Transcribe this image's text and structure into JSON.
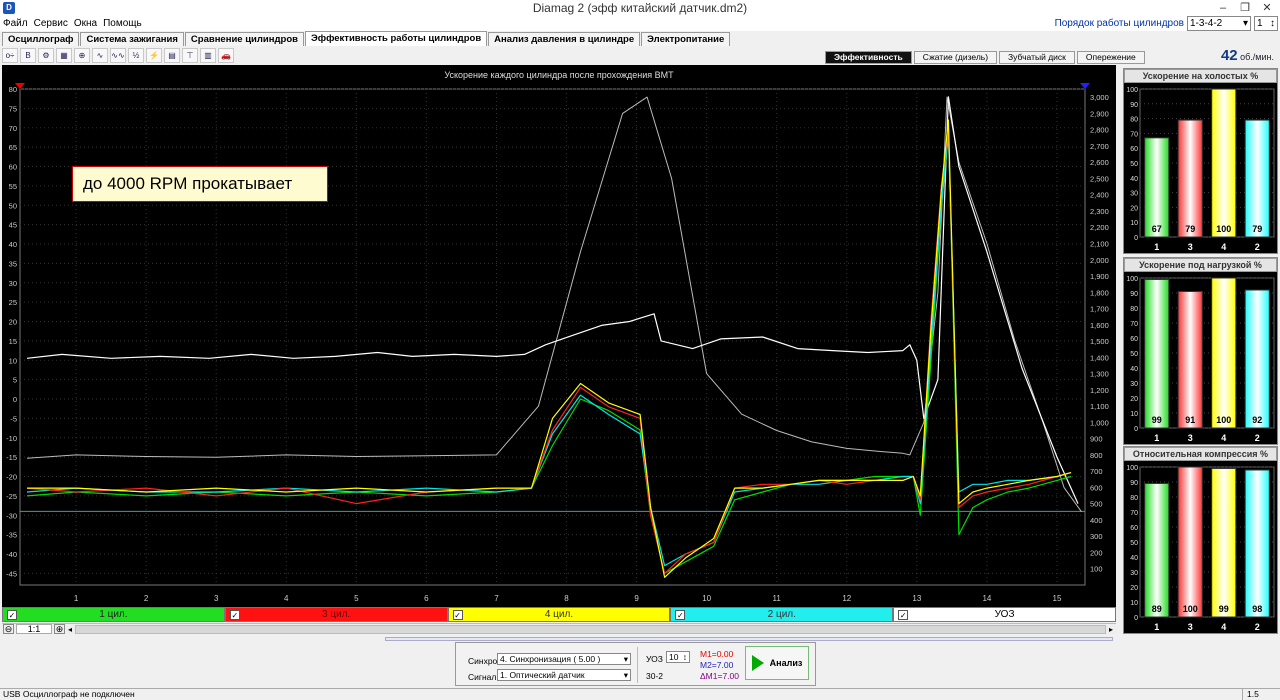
{
  "window": {
    "app_icon": "D",
    "title": "Diamag 2 (эфф китайский датчик.dm2)",
    "minimize": "–",
    "restore": "❐",
    "close": "✕"
  },
  "menu": [
    "Файл",
    "Сервис",
    "Окна",
    "Помощь"
  ],
  "cylinder_order": {
    "label": "Порядок работы цилиндров",
    "value": "1-3-4-2",
    "count": "1"
  },
  "tabs": [
    {
      "label": "Осциллограф",
      "active": false
    },
    {
      "label": "Система зажигания",
      "active": false
    },
    {
      "label": "Сравнение цилиндров",
      "active": false
    },
    {
      "label": "Эффективность работы цилиндров",
      "active": true
    },
    {
      "label": "Анализ давления в цилиндре",
      "active": false
    },
    {
      "label": "Электропитание",
      "active": false
    }
  ],
  "toolbar_icons": [
    "scale-icon",
    "marker-b-icon",
    "rpm-icon",
    "grid-icon",
    "cursor-icon",
    "wave-icon",
    "wave-vvt-icon",
    "alg-icon",
    "sensor-icon",
    "table-icon",
    "filter-icon",
    "bar-chart-icon",
    "car-icon"
  ],
  "toolbar_glyphs": [
    "o÷",
    "B",
    "⚙",
    "▦",
    "⊕",
    "∿",
    "∿∿",
    "½",
    "⚡",
    "▤",
    "⊤",
    "▥",
    "🚗"
  ],
  "subtabs": [
    {
      "label": "Эффективность",
      "active": true
    },
    {
      "label": "Сжатие (дизель)",
      "active": false
    },
    {
      "label": "Зубчатый диск",
      "active": false
    },
    {
      "label": "Опережение",
      "active": false
    }
  ],
  "rpm": {
    "value": "42",
    "unit": "об./мин."
  },
  "annotation": "до 4000 RPM прокатывает",
  "chart_data": {
    "type": "line",
    "title": "Ускорение каждого цилиндра после прохождения ВМТ",
    "x_ticks": [
      "1",
      "2",
      "3",
      "4",
      "5",
      "6",
      "7",
      "8",
      "9",
      "10",
      "11",
      "12",
      "13",
      "14",
      "15"
    ],
    "xlim": [
      0.2,
      15.4
    ],
    "y_left_ticks": [
      "80",
      "75",
      "70",
      "65",
      "60",
      "55",
      "50",
      "45",
      "40",
      "35",
      "30",
      "25",
      "20",
      "15",
      "10",
      "5",
      "0",
      "-5",
      "-10",
      "-15",
      "-20",
      "-25",
      "-30",
      "-35",
      "-40",
      "-45"
    ],
    "ylim_left": [
      -48,
      80
    ],
    "y_right_ticks": [
      "3,000",
      "2,900",
      "2,800",
      "2,700",
      "2,600",
      "2,500",
      "2,400",
      "2,300",
      "2,200",
      "2,100",
      "2,000",
      "1,900",
      "1,800",
      "1,700",
      "1,600",
      "1,500",
      "1,400",
      "1,300",
      "1,200",
      "1,100",
      "1,000",
      "900",
      "800",
      "700",
      "600",
      "500",
      "400",
      "300",
      "200",
      "100"
    ],
    "ylim_right": [
      0,
      3050
    ],
    "grid": true,
    "reference_line_y": -29,
    "series": [
      {
        "name": "1 цил.",
        "color": "#00dd00",
        "axis": "left",
        "x": [
          0.3,
          1,
          2,
          3,
          4,
          5,
          6,
          7,
          7.5,
          7.8,
          8.2,
          8.6,
          9.05,
          9.2,
          9.4,
          9.7,
          10.1,
          10.4,
          10.8,
          11.2,
          11.6,
          12,
          12.4,
          12.8,
          12.95,
          13.05,
          13.2,
          13.35,
          13.45,
          13.6,
          13.8,
          14,
          14.3,
          14.6,
          15,
          15.2
        ],
        "y": [
          -25,
          -24,
          -25,
          -24,
          -25,
          -24,
          -25,
          -24,
          -23,
          -12,
          0,
          -3,
          -8,
          -30,
          -45,
          -42,
          -38,
          -26,
          -24,
          -22,
          -21,
          -21,
          -20,
          -20,
          -20,
          -30,
          10,
          50,
          70,
          -35,
          -28,
          -26,
          -24,
          -23,
          -21,
          -20
        ]
      },
      {
        "name": "3 цил.",
        "color": "#ff2222",
        "axis": "left",
        "x": [
          0.3,
          1,
          2,
          3,
          4,
          5,
          6,
          7,
          7.5,
          7.8,
          8.2,
          8.6,
          9.05,
          9.2,
          9.4,
          9.7,
          10.1,
          10.4,
          10.8,
          11.2,
          11.6,
          12,
          12.4,
          12.8,
          12.95,
          13.05,
          13.2,
          13.35,
          13.45,
          13.6,
          13.8,
          14,
          14.3,
          14.6,
          15,
          15.2
        ],
        "y": [
          -23,
          -24,
          -23,
          -25,
          -23,
          -27,
          -24,
          -23,
          -23,
          -8,
          3,
          -2,
          -5,
          -30,
          -45,
          -40,
          -37,
          -23,
          -22,
          -22,
          -21,
          -22,
          -21,
          -21,
          -20,
          -26,
          20,
          55,
          70,
          -28,
          -25,
          -24,
          -23,
          -22,
          -20,
          -19
        ]
      },
      {
        "name": "4 цил.",
        "color": "#ffff00",
        "axis": "left",
        "x": [
          0.3,
          1,
          2,
          3,
          4,
          5,
          6,
          7,
          7.5,
          7.8,
          8.2,
          8.6,
          9.05,
          9.2,
          9.4,
          9.7,
          10.1,
          10.4,
          10.8,
          11.2,
          11.6,
          12,
          12.4,
          12.8,
          12.95,
          13.05,
          13.2,
          13.35,
          13.45,
          13.6,
          13.8,
          14,
          14.3,
          14.6,
          15,
          15.2
        ],
        "y": [
          -23,
          -23,
          -24,
          -23,
          -24,
          -23,
          -24,
          -23,
          -23,
          -5,
          4,
          -1,
          -4,
          -28,
          -46,
          -41,
          -36,
          -23,
          -23,
          -22,
          -21,
          -21,
          -21,
          -21,
          -20,
          -25,
          18,
          54,
          72,
          -27,
          -24,
          -23,
          -22,
          -21,
          -20,
          -19
        ]
      },
      {
        "name": "2 цил.",
        "color": "#00e5e5",
        "axis": "left",
        "x": [
          0.3,
          1,
          2,
          3,
          4,
          5,
          6,
          7,
          7.5,
          7.8,
          8.2,
          8.6,
          9.05,
          9.2,
          9.4,
          9.7,
          10.1,
          10.4,
          10.8,
          11.2,
          11.6,
          12,
          12.4,
          12.8,
          12.95,
          13.05,
          13.2,
          13.35,
          13.45,
          13.6,
          13.8,
          14,
          14.3,
          14.6,
          15,
          15.2
        ],
        "y": [
          -24,
          -23,
          -24,
          -24,
          -23,
          -24,
          -23,
          -24,
          -23,
          -9,
          1,
          -4,
          -9,
          -28,
          -43,
          -40,
          -37,
          -24,
          -23,
          -22,
          -22,
          -21,
          -21,
          -20,
          -20,
          -27,
          14,
          50,
          68,
          -24,
          -22,
          -22,
          -21,
          -21,
          -20,
          -19
        ]
      },
      {
        "name": "УОЗ",
        "color": "#ffffff",
        "axis": "left",
        "x": [
          0.3,
          0.8,
          1.5,
          2.2,
          2.9,
          3.5,
          4.1,
          4.7,
          5.3,
          5.8,
          6.4,
          7,
          7.4,
          7.7,
          8.1,
          8.5,
          8.9,
          9.25,
          9.35,
          9.8,
          10.2,
          10.8,
          11.3,
          11.8,
          12.3,
          12.8,
          12.9,
          13.0,
          13.1,
          13.3,
          13.45,
          13.6,
          14,
          14.5,
          15,
          15.3
        ],
        "y": [
          10.5,
          11.5,
          10.5,
          11,
          10.5,
          11.5,
          10.5,
          11,
          12,
          11,
          11.5,
          11,
          11.5,
          14,
          16.5,
          19,
          20,
          22,
          15,
          13,
          15.5,
          16,
          13,
          12.5,
          12,
          12.5,
          14,
          10,
          -5,
          5,
          78,
          60,
          38,
          8,
          -15,
          -27
        ]
      },
      {
        "name": "RPM",
        "color": "#bbbbbb",
        "axis": "right",
        "x": [
          0.3,
          1,
          2,
          3,
          4,
          5,
          6,
          7,
          7.6,
          8.2,
          8.8,
          9.15,
          9.5,
          10,
          10.5,
          11,
          11.5,
          12,
          12.5,
          12.8,
          12.9,
          13.1,
          13.3,
          13.43,
          13.6,
          14,
          14.4,
          14.8,
          15.1,
          15.35
        ],
        "y": [
          780,
          800,
          790,
          785,
          800,
          790,
          795,
          800,
          1100,
          2050,
          2900,
          3000,
          2500,
          1300,
          1050,
          950,
          880,
          840,
          820,
          810,
          800,
          1000,
          1800,
          3000,
          2600,
          2100,
          1500,
          1000,
          600,
          450
        ]
      }
    ]
  },
  "legend": [
    {
      "label": "1 цил.",
      "bg": "#22dd22",
      "text_color": "#222222"
    },
    {
      "label": "3 цил.",
      "bg": "#ff1111",
      "text_color": "#660000"
    },
    {
      "label": "4 цил.",
      "bg": "#ffff00",
      "text_color": "#333333"
    },
    {
      "label": "2 цил.",
      "bg": "#22eeee",
      "text_color": "#333333"
    },
    {
      "label": "УОЗ",
      "bg": "#ffffff",
      "text_color": "#000000"
    }
  ],
  "zoom": "1:1",
  "bottom": {
    "sync_label": "Синхро:",
    "sync_value": "4.  Синхронизация ( 5.00 )",
    "signal_label": "Сигнал:",
    "signal_value": "1.  Оптический датчик",
    "uoz_label": "УОЗ",
    "uoz_value": "10",
    "teeth": "30-2",
    "m1": "M1=0.00",
    "m2": "M2=7.00",
    "dm1": "ΔM1=7.00",
    "analyze": "Анализ"
  },
  "status": {
    "left": "USB Осциллограф не подключен",
    "right": "1.5"
  },
  "right_panels": [
    {
      "title": "Ускорение на холостых %",
      "y_ticks": [
        "100",
        "90",
        "80",
        "70",
        "60",
        "50",
        "40",
        "30",
        "20",
        "10",
        "0"
      ],
      "categories": [
        "1",
        "3",
        "4",
        "2"
      ],
      "values": [
        67,
        79,
        100,
        79
      ],
      "value_labels": [
        "67",
        "79",
        "100",
        "79"
      ],
      "colors": [
        "#22dd22",
        "#ff3333",
        "#ffff00",
        "#22ffff"
      ]
    },
    {
      "title": "Ускорение под нагрузкой %",
      "y_ticks": [
        "100",
        "90",
        "80",
        "70",
        "60",
        "50",
        "40",
        "30",
        "20",
        "10",
        "0"
      ],
      "categories": [
        "1",
        "3",
        "4",
        "2"
      ],
      "values": [
        99,
        91,
        100,
        92
      ],
      "value_labels": [
        "99",
        "91",
        "100",
        "92"
      ],
      "colors": [
        "#22dd22",
        "#ff3333",
        "#ffff00",
        "#22ffff"
      ]
    },
    {
      "title": "Относительная компрессия %",
      "y_ticks": [
        "100",
        "90",
        "80",
        "70",
        "60",
        "50",
        "40",
        "30",
        "20",
        "10",
        "0"
      ],
      "categories": [
        "1",
        "3",
        "4",
        "2"
      ],
      "values": [
        89,
        100,
        99,
        98
      ],
      "value_labels": [
        "89",
        "100",
        "99",
        "98"
      ],
      "colors": [
        "#22dd22",
        "#ff3333",
        "#ffff00",
        "#22ffff"
      ]
    }
  ]
}
